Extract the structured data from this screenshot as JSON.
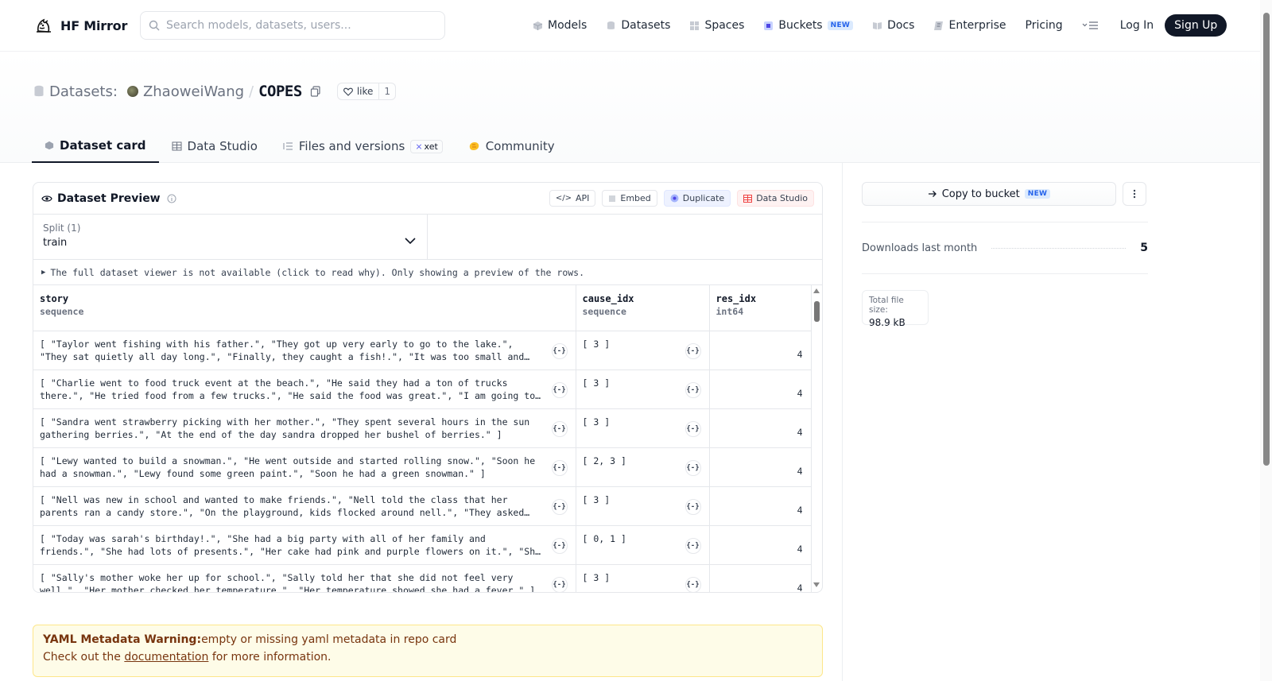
{
  "brand": {
    "name": "HF Mirror"
  },
  "search": {
    "placeholder": "Search models, datasets, users..."
  },
  "nav": {
    "models": "Models",
    "datasets": "Datasets",
    "spaces": "Spaces",
    "buckets": "Buckets",
    "buckets_badge": "NEW",
    "docs": "Docs",
    "enterprise": "Enterprise",
    "pricing": "Pricing",
    "login": "Log In",
    "signup": "Sign Up"
  },
  "repo": {
    "type_label": "Datasets:",
    "owner": "ZhaoweiWang",
    "separator": "/",
    "name": "COPES",
    "like_label": "like",
    "like_count": "1"
  },
  "tabs": [
    {
      "label": "Dataset card",
      "active": true
    },
    {
      "label": "Data Studio"
    },
    {
      "label": "Files and versions",
      "badge": "xet"
    },
    {
      "label": "Community"
    }
  ],
  "preview": {
    "title": "Dataset Preview",
    "actions": {
      "api": "API",
      "embed": "Embed",
      "duplicate": "Duplicate",
      "data_studio": "Data Studio"
    },
    "split_label": "Split (1)",
    "split_value": "train",
    "notice": "The full dataset viewer is not available (click to read why). Only showing a preview of the rows.",
    "columns": [
      {
        "name": "story",
        "type": "sequence"
      },
      {
        "name": "cause_idx",
        "type": "sequence"
      },
      {
        "name": "res_idx",
        "type": "int64"
      }
    ],
    "json_button": "{-}",
    "rows": [
      {
        "story": "[ \"Taylor went fishing with his father.\", \"They got up very early to go to the lake.\", \"They sat quietly all day long.\", \"Finally, they caught a fish!.\", \"It was too small and they had to throw it back.\" ]",
        "cause": "[ 3 ]",
        "res": "4"
      },
      {
        "story": "[ \"Charlie went to food truck event at the beach.\", \"He said they had a ton of trucks there.\", \"He tried food from a few trucks.\", \"He said the food was great.\", \"I am going to go with him next time.\" ]",
        "cause": "[ 3 ]",
        "res": "4"
      },
      {
        "story": "[ \"Sandra went strawberry picking with her mother.\", \"They spent several hours in the sun gathering berries.\", \"At the end of the day sandra dropped her bushel of berries.\" ]",
        "cause": "[ 3 ]",
        "res": "4"
      },
      {
        "story": "[ \"Lewy wanted to build a snowman.\", \"He went outside and started rolling snow.\", \"Soon he had a snowman.\", \"Lewy found some green paint.\", \"Soon he had a green snowman.\" ]",
        "cause": "[ 2, 3 ]",
        "res": "4"
      },
      {
        "story": "[ \"Nell was new in school and wanted to make friends.\", \"Nell told the class that her parents ran a candy store.\", \"On the playground, kids flocked around nell.\", \"They asked her for candy.\" ]",
        "cause": "[ 3 ]",
        "res": "4"
      },
      {
        "story": "[ \"Today was sarah's birthday!.\", \"She had a big party with all of her family and friends.\", \"She had lots of presents.\", \"Her cake had pink and purple flowers on it.\", \"She was very happy.\" ]",
        "cause": "[ 0, 1 ]",
        "res": "4"
      },
      {
        "story": "[ \"Sally's mother woke her up for school.\", \"Sally told her that she did not feel very well.\", \"Her mother checked her temperature.\", \"Her temperature showed she had a fever.\" ]",
        "cause": "[ 3 ]",
        "res": "4"
      }
    ]
  },
  "warning": {
    "title": "YAML Metadata Warning:",
    "message": "empty or missing yaml metadata in repo card",
    "line2_prefix": "Check out the ",
    "link": "documentation",
    "line2_suffix": " for more information."
  },
  "sidebar": {
    "copy_label": "Copy to bucket",
    "copy_badge": "NEW",
    "downloads_label": "Downloads last month",
    "downloads_count": "5",
    "filesize_label": "Total file size:",
    "filesize_value": "98.9 kB"
  },
  "colors": {
    "primary": "#111827",
    "accent_blue": "#2563eb",
    "warning_bg": "#fefce8"
  }
}
